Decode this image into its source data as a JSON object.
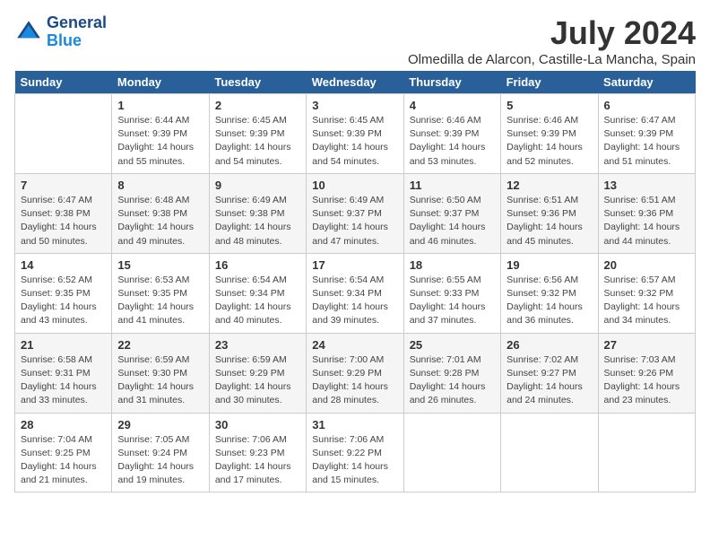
{
  "logo": {
    "line1": "General",
    "line2": "Blue"
  },
  "title": "July 2024",
  "subtitle": "Olmedilla de Alarcon, Castille-La Mancha, Spain",
  "days_of_week": [
    "Sunday",
    "Monday",
    "Tuesday",
    "Wednesday",
    "Thursday",
    "Friday",
    "Saturday"
  ],
  "weeks": [
    [
      {
        "num": "",
        "info": ""
      },
      {
        "num": "1",
        "info": "Sunrise: 6:44 AM\nSunset: 9:39 PM\nDaylight: 14 hours\nand 55 minutes."
      },
      {
        "num": "2",
        "info": "Sunrise: 6:45 AM\nSunset: 9:39 PM\nDaylight: 14 hours\nand 54 minutes."
      },
      {
        "num": "3",
        "info": "Sunrise: 6:45 AM\nSunset: 9:39 PM\nDaylight: 14 hours\nand 54 minutes."
      },
      {
        "num": "4",
        "info": "Sunrise: 6:46 AM\nSunset: 9:39 PM\nDaylight: 14 hours\nand 53 minutes."
      },
      {
        "num": "5",
        "info": "Sunrise: 6:46 AM\nSunset: 9:39 PM\nDaylight: 14 hours\nand 52 minutes."
      },
      {
        "num": "6",
        "info": "Sunrise: 6:47 AM\nSunset: 9:39 PM\nDaylight: 14 hours\nand 51 minutes."
      }
    ],
    [
      {
        "num": "7",
        "info": "Sunrise: 6:47 AM\nSunset: 9:38 PM\nDaylight: 14 hours\nand 50 minutes."
      },
      {
        "num": "8",
        "info": "Sunrise: 6:48 AM\nSunset: 9:38 PM\nDaylight: 14 hours\nand 49 minutes."
      },
      {
        "num": "9",
        "info": "Sunrise: 6:49 AM\nSunset: 9:38 PM\nDaylight: 14 hours\nand 48 minutes."
      },
      {
        "num": "10",
        "info": "Sunrise: 6:49 AM\nSunset: 9:37 PM\nDaylight: 14 hours\nand 47 minutes."
      },
      {
        "num": "11",
        "info": "Sunrise: 6:50 AM\nSunset: 9:37 PM\nDaylight: 14 hours\nand 46 minutes."
      },
      {
        "num": "12",
        "info": "Sunrise: 6:51 AM\nSunset: 9:36 PM\nDaylight: 14 hours\nand 45 minutes."
      },
      {
        "num": "13",
        "info": "Sunrise: 6:51 AM\nSunset: 9:36 PM\nDaylight: 14 hours\nand 44 minutes."
      }
    ],
    [
      {
        "num": "14",
        "info": "Sunrise: 6:52 AM\nSunset: 9:35 PM\nDaylight: 14 hours\nand 43 minutes."
      },
      {
        "num": "15",
        "info": "Sunrise: 6:53 AM\nSunset: 9:35 PM\nDaylight: 14 hours\nand 41 minutes."
      },
      {
        "num": "16",
        "info": "Sunrise: 6:54 AM\nSunset: 9:34 PM\nDaylight: 14 hours\nand 40 minutes."
      },
      {
        "num": "17",
        "info": "Sunrise: 6:54 AM\nSunset: 9:34 PM\nDaylight: 14 hours\nand 39 minutes."
      },
      {
        "num": "18",
        "info": "Sunrise: 6:55 AM\nSunset: 9:33 PM\nDaylight: 14 hours\nand 37 minutes."
      },
      {
        "num": "19",
        "info": "Sunrise: 6:56 AM\nSunset: 9:32 PM\nDaylight: 14 hours\nand 36 minutes."
      },
      {
        "num": "20",
        "info": "Sunrise: 6:57 AM\nSunset: 9:32 PM\nDaylight: 14 hours\nand 34 minutes."
      }
    ],
    [
      {
        "num": "21",
        "info": "Sunrise: 6:58 AM\nSunset: 9:31 PM\nDaylight: 14 hours\nand 33 minutes."
      },
      {
        "num": "22",
        "info": "Sunrise: 6:59 AM\nSunset: 9:30 PM\nDaylight: 14 hours\nand 31 minutes."
      },
      {
        "num": "23",
        "info": "Sunrise: 6:59 AM\nSunset: 9:29 PM\nDaylight: 14 hours\nand 30 minutes."
      },
      {
        "num": "24",
        "info": "Sunrise: 7:00 AM\nSunset: 9:29 PM\nDaylight: 14 hours\nand 28 minutes."
      },
      {
        "num": "25",
        "info": "Sunrise: 7:01 AM\nSunset: 9:28 PM\nDaylight: 14 hours\nand 26 minutes."
      },
      {
        "num": "26",
        "info": "Sunrise: 7:02 AM\nSunset: 9:27 PM\nDaylight: 14 hours\nand 24 minutes."
      },
      {
        "num": "27",
        "info": "Sunrise: 7:03 AM\nSunset: 9:26 PM\nDaylight: 14 hours\nand 23 minutes."
      }
    ],
    [
      {
        "num": "28",
        "info": "Sunrise: 7:04 AM\nSunset: 9:25 PM\nDaylight: 14 hours\nand 21 minutes."
      },
      {
        "num": "29",
        "info": "Sunrise: 7:05 AM\nSunset: 9:24 PM\nDaylight: 14 hours\nand 19 minutes."
      },
      {
        "num": "30",
        "info": "Sunrise: 7:06 AM\nSunset: 9:23 PM\nDaylight: 14 hours\nand 17 minutes."
      },
      {
        "num": "31",
        "info": "Sunrise: 7:06 AM\nSunset: 9:22 PM\nDaylight: 14 hours\nand 15 minutes."
      },
      {
        "num": "",
        "info": ""
      },
      {
        "num": "",
        "info": ""
      },
      {
        "num": "",
        "info": ""
      }
    ]
  ]
}
